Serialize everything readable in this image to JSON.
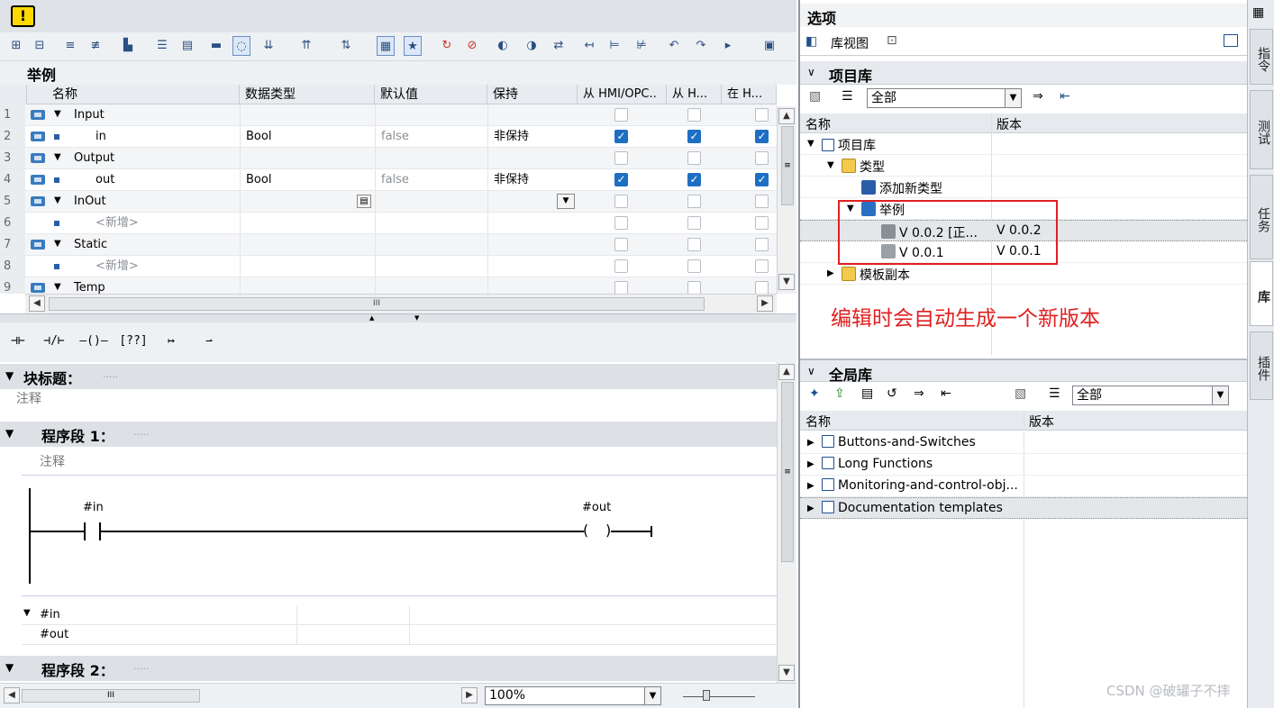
{
  "warning_icon": "warning-icon",
  "interface": {
    "title": "举例",
    "columns": [
      "名称",
      "数据类型",
      "默认值",
      "保持",
      "从 HMI/OPC..",
      "从 H...",
      "在 H..."
    ],
    "rows": [
      {
        "num": "1",
        "indent": 0,
        "expand": "▼",
        "icon": "param-icon",
        "name": "Input",
        "type": "",
        "default": "",
        "retain": "",
        "c1": null,
        "c2": null,
        "c3": null
      },
      {
        "num": "2",
        "indent": 1,
        "expand": "",
        "icon": "param-icon",
        "name": "in",
        "type": "Bool",
        "default": "false",
        "retain": "非保持",
        "c1": true,
        "c2": true,
        "c3": true
      },
      {
        "num": "3",
        "indent": 0,
        "expand": "▼",
        "icon": "param-icon",
        "name": "Output",
        "type": "",
        "default": "",
        "retain": "",
        "c1": null,
        "c2": null,
        "c3": null
      },
      {
        "num": "4",
        "indent": 1,
        "expand": "",
        "icon": "param-icon",
        "name": "out",
        "type": "Bool",
        "default": "false",
        "retain": "非保持",
        "c1": true,
        "c2": true,
        "c3": true
      },
      {
        "num": "5",
        "indent": 0,
        "expand": "▼",
        "icon": "param-icon",
        "name": "InOut",
        "type": "",
        "default": "",
        "retain": "",
        "c1": null,
        "c2": null,
        "c3": null
      },
      {
        "num": "6",
        "indent": 1,
        "expand": "",
        "icon": "",
        "name": "<新增>",
        "type": "",
        "default": "",
        "retain": "",
        "c1": null,
        "c2": null,
        "c3": null
      },
      {
        "num": "7",
        "indent": 0,
        "expand": "▼",
        "icon": "param-icon",
        "name": "Static",
        "type": "",
        "default": "",
        "retain": "",
        "c1": null,
        "c2": null,
        "c3": null
      },
      {
        "num": "8",
        "indent": 1,
        "expand": "",
        "icon": "",
        "name": "<新增>",
        "type": "",
        "default": "",
        "retain": "",
        "c1": null,
        "c2": null,
        "c3": null
      },
      {
        "num": "9",
        "indent": 0,
        "expand": "▼",
        "icon": "param-icon",
        "name": "Temp",
        "type": "",
        "default": "",
        "retain": "",
        "c1": null,
        "c2": null,
        "c3": null
      }
    ],
    "hscroll_mark": "III"
  },
  "ladder_toolbar": [
    "⊣⊢",
    "⊣/⊢",
    "–()–",
    "[??]",
    "↦",
    "⇀"
  ],
  "block": {
    "title_label": "块标题：",
    "title_dots": ".....",
    "comment": "注释",
    "network1_label": "程序段 1：",
    "network1_dots": ".....",
    "network1_comment": "注释",
    "contact_operand": "#in",
    "coil_operand": "#out",
    "operand_list": [
      "#in",
      "#out"
    ],
    "network2_label": "程序段 2：",
    "network2_dots": ".....",
    "zoom": "100%",
    "hscroll_mark": "III"
  },
  "options": {
    "title": "选项",
    "lib_view_label": "库视图",
    "project_lib": {
      "title": "项目库",
      "filter": "全部",
      "col_name": "名称",
      "col_version": "版本",
      "tree": [
        {
          "indent": 0,
          "exp": "▼",
          "icon": "book-icon",
          "name": "项目库",
          "version": ""
        },
        {
          "indent": 1,
          "exp": "▼",
          "icon": "folder-icon",
          "name": "类型",
          "version": ""
        },
        {
          "indent": 2,
          "exp": "",
          "icon": "add-type-icon",
          "name": "添加新类型",
          "version": ""
        },
        {
          "indent": 2,
          "exp": "▼",
          "icon": "block-type-icon",
          "name": "举例",
          "version": ""
        },
        {
          "indent": 3,
          "exp": "",
          "icon": "version-edit-icon",
          "name": "V 0.0.2 [正...",
          "version": "V 0.0.2"
        },
        {
          "indent": 3,
          "exp": "",
          "icon": "version-released-icon",
          "name": "V 0.0.1",
          "version": "V 0.0.1"
        },
        {
          "indent": 1,
          "exp": "▶",
          "icon": "folder-icon",
          "name": "模板副本",
          "version": ""
        }
      ],
      "annotation": "编辑时会自动生成一个新版本",
      "annotation_color": "#e02020"
    },
    "global_lib": {
      "title": "全局库",
      "filter": "全部",
      "col_name": "名称",
      "col_version": "版本",
      "items": [
        "Buttons-and-Switches",
        "Long Functions",
        "Monitoring-and-control-obj...",
        "Documentation templates"
      ]
    }
  },
  "side_tabs": [
    "指令",
    "测试",
    "任务",
    "库",
    "插件"
  ],
  "watermark": "CSDN @破罐子不摔"
}
